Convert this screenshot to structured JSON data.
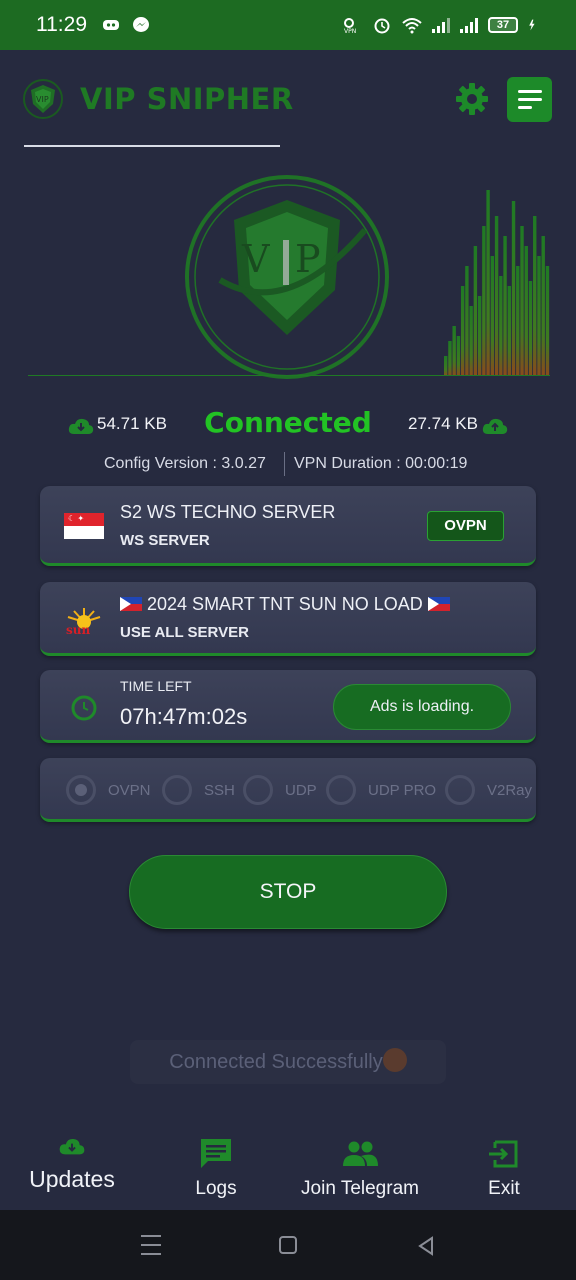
{
  "status_bar": {
    "time": "11:29",
    "battery": "37"
  },
  "header": {
    "app_title": "VIP SNIPHER"
  },
  "stats": {
    "download": "54.71 KB",
    "status": "Connected",
    "upload": "27.74 KB",
    "config_version": "Config Version : 3.0.27",
    "vpn_duration": "VPN Duration : 00:00:19"
  },
  "server_card": {
    "title": "S2 WS TECHNO SERVER",
    "subtitle": "WS SERVER",
    "badge": "OVPN"
  },
  "network_card": {
    "title": "2024 SMART TNT SUN NO LOAD",
    "subtitle": "USE ALL SERVER",
    "logo_text": "sun"
  },
  "timer_card": {
    "label": "TIME LEFT",
    "time_left": "07h:47m:02s",
    "ads_button": "Ads is loading."
  },
  "protocols": [
    {
      "label": "OVPN",
      "checked": true
    },
    {
      "label": "SSH",
      "checked": false
    },
    {
      "label": "UDP",
      "checked": false
    },
    {
      "label": "UDP PRO",
      "checked": false
    },
    {
      "label": "V2Ray",
      "checked": false
    }
  ],
  "stop_button": "STOP",
  "toast": "Connected Successfully",
  "bottom_nav": {
    "updates": "Updates",
    "logs": "Logs",
    "telegram": "Join Telegram",
    "exit": "Exit"
  },
  "colors": {
    "accent": "#1d8a29",
    "status_green": "#22c324",
    "background": "#262a3f"
  }
}
